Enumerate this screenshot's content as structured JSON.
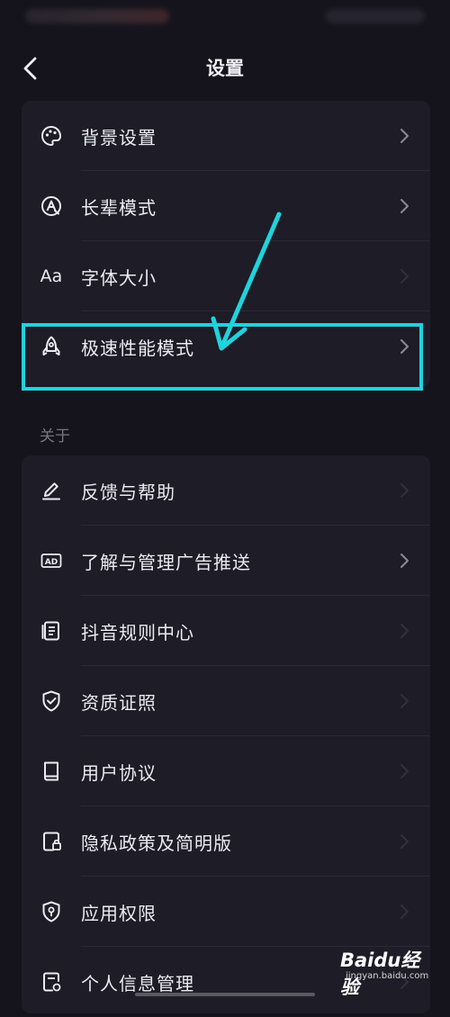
{
  "nav": {
    "title": "设置",
    "back_icon": "chevron-left-icon"
  },
  "settings_group": {
    "items": [
      {
        "label": "背景设置",
        "icon": "palette-icon",
        "chevron": "visible"
      },
      {
        "label": "长辈模式",
        "icon": "elder-mode-icon",
        "chevron": "visible"
      },
      {
        "label": "字体大小",
        "icon": "font-size-icon",
        "icon_text": "Aa",
        "chevron": "faded"
      },
      {
        "label": "极速性能模式",
        "icon": "rocket-icon",
        "chevron": "visible",
        "highlighted": true
      }
    ]
  },
  "about_section": {
    "header": "关于",
    "items": [
      {
        "label": "反馈与帮助",
        "icon": "pencil-icon",
        "chevron": "faded"
      },
      {
        "label": "了解与管理广告推送",
        "icon": "ad-icon",
        "icon_text": "AD",
        "chevron": "visible"
      },
      {
        "label": "抖音规则中心",
        "icon": "rules-doc-icon",
        "chevron": "faded"
      },
      {
        "label": "资质证照",
        "icon": "shield-check-icon",
        "chevron": "faded"
      },
      {
        "label": "用户协议",
        "icon": "book-icon",
        "chevron": "faded"
      },
      {
        "label": "隐私政策及简明版",
        "icon": "privacy-lock-icon",
        "chevron": "faded"
      },
      {
        "label": "应用权限",
        "icon": "permission-shield-icon",
        "chevron": "faded"
      },
      {
        "label": "个人信息管理",
        "icon": "personal-info-icon",
        "chevron": "faded"
      }
    ]
  },
  "annotation": {
    "highlight_color": "#1fd3dc"
  },
  "watermark": {
    "logo": "Bai du 经验",
    "logo_main": "Bai",
    "logo_paw": "du",
    "logo_cn": "经验",
    "url": "jingyan.baidu.com"
  },
  "colors": {
    "background": "#15141d",
    "card": "#1d1c27",
    "text": "#ecebf1",
    "muted": "#77767f",
    "accent": "#1fd3dc"
  }
}
